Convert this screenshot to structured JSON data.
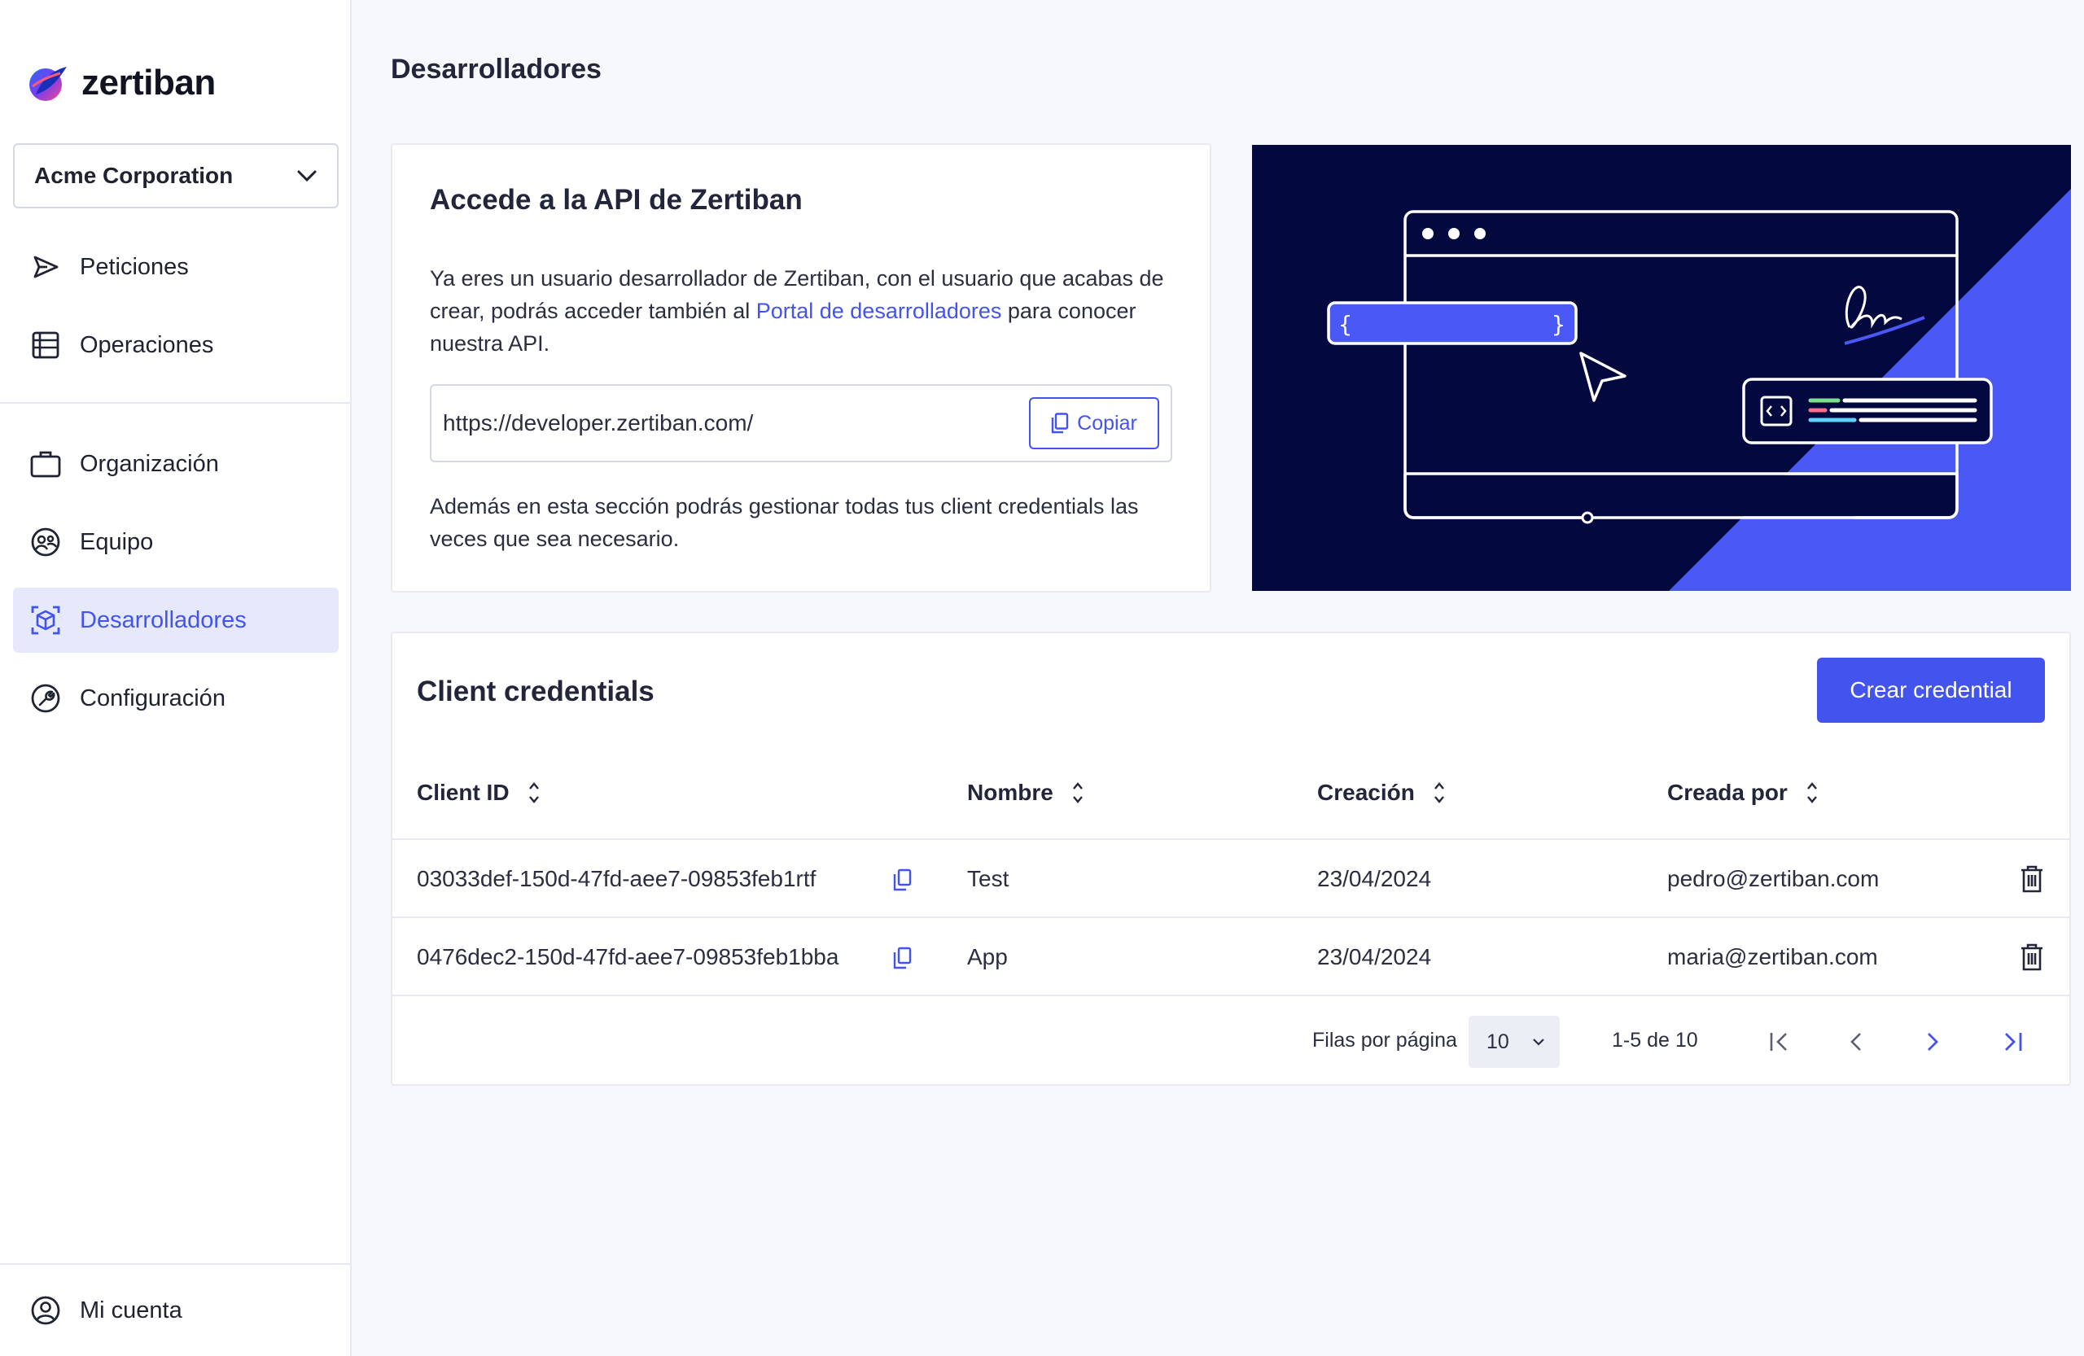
{
  "brand": {
    "name": "zertiban",
    "colors": {
      "accent": "#4353ee",
      "navy": "#03083f",
      "active_bg": "#e6e9fc"
    }
  },
  "org_selector": {
    "selected": "Acme Corporation",
    "icon": "chevron-down-icon"
  },
  "sidebar": {
    "items": [
      {
        "label": "Peticiones",
        "icon": "send-icon"
      },
      {
        "label": "Operaciones",
        "icon": "list-icon"
      },
      {
        "label": "Organización",
        "icon": "briefcase-icon"
      },
      {
        "label": "Equipo",
        "icon": "team-icon"
      },
      {
        "label": "Desarrolladores",
        "icon": "cube-icon",
        "active": true
      },
      {
        "label": "Configuración",
        "icon": "wrench-icon"
      }
    ],
    "account": {
      "label": "Mi cuenta",
      "icon": "user-circle-icon"
    }
  },
  "page": {
    "title": "Desarrolladores"
  },
  "api_card": {
    "title": "Accede a la API de Zertiban",
    "text_before_link": "Ya eres un usuario desarrollador de Zertiban, con el usuario que acabas de crear, podrás acceder también al ",
    "link_text": "Portal de desarrolladores",
    "text_after_link": " para conocer nuestra API.",
    "url": "https://developer.zertiban.com/",
    "copy_label": "Copiar",
    "footer_text": "Además en esta sección podrás gestionar todas tus client credentials las veces que sea necesario."
  },
  "credentials": {
    "title": "Client credentials",
    "create_label": "Crear credential",
    "columns": [
      "Client ID",
      "Nombre",
      "Creación",
      "Creada por"
    ],
    "rows": [
      {
        "client_id": "03033def-150d-47fd-aee7-09853feb1rtf",
        "name": "Test",
        "created": "23/04/2024",
        "created_by": "pedro@zertiban.com"
      },
      {
        "client_id": "0476dec2-150d-47fd-aee7-09853feb1bba",
        "name": "App",
        "created": "23/04/2024",
        "created_by": "maria@zertiban.com"
      }
    ],
    "pagination": {
      "rows_per_page_label": "Filas por página",
      "rows_per_page": "10",
      "range": "1-5 de 10"
    }
  }
}
